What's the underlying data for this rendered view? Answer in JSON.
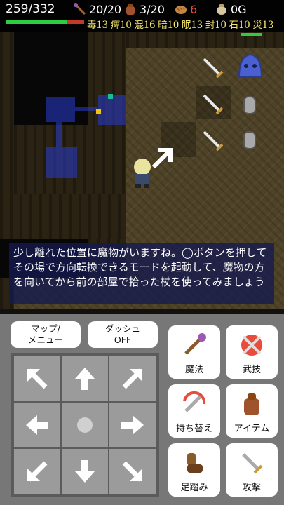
{
  "hud": {
    "hp": "259/332",
    "hp_fraction": 0.78,
    "staff": "20/20",
    "bag": "3/20",
    "bread": "6",
    "gold": "0G",
    "resists": "毒13 痺10 混16 暗10 眠13 封10 石10 災13"
  },
  "message": "少し離れた位置に魔物がいますね。◯ボタンを押してその場で方向転換できるモードを起動して、魔物の方を向いてから前の部屋で拾った杖を使ってみましょう",
  "controls": {
    "map_menu": [
      "マップ/",
      "メニュー"
    ],
    "dash": [
      "ダッシュ",
      "OFF"
    ],
    "actions": {
      "magic": "魔法",
      "skill": "武技",
      "swap": "持ち替え",
      "item": "アイテム",
      "step": "足踏み",
      "attack": "攻撃"
    }
  },
  "colors": {
    "hp_green": "#2ecc40",
    "hp_red": "#c0392b",
    "resist_yellow": "#f3e46e",
    "bread_red": "#e74c3c"
  }
}
